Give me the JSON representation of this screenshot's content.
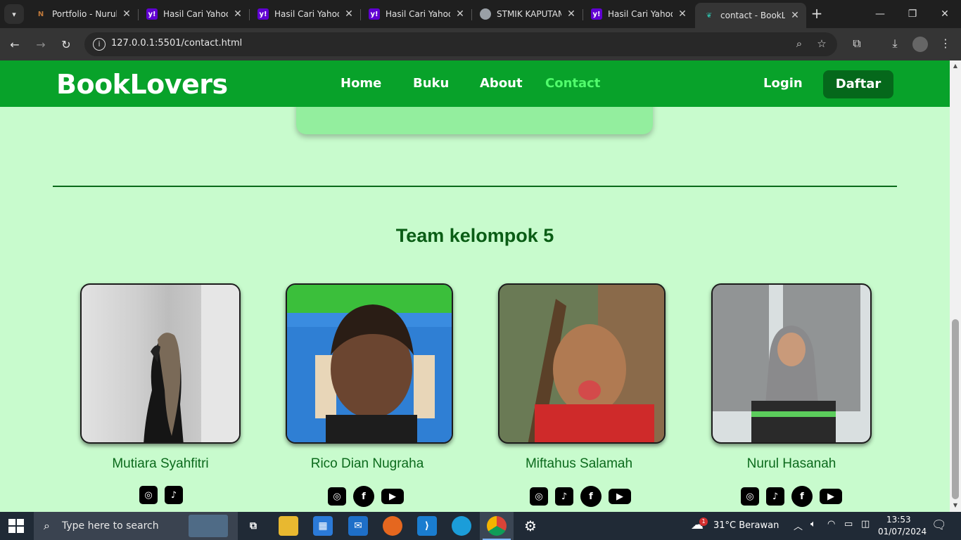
{
  "browser": {
    "tabs": [
      {
        "title": "Portfolio - Nurul",
        "favicon": "N",
        "favicon_color": "#c0793a"
      },
      {
        "title": "Hasil Cari Yahoo",
        "favicon": "y!",
        "favicon_color": "#6001d2"
      },
      {
        "title": "Hasil Cari Yahoo",
        "favicon": "y!",
        "favicon_color": "#6001d2"
      },
      {
        "title": "Hasil Cari Yahoo",
        "favicon": "y!",
        "favicon_color": "#6001d2"
      },
      {
        "title": "STMIK KAPUTAM",
        "favicon": "globe",
        "favicon_color": "#9aa0a6"
      },
      {
        "title": "Hasil Cari Yahoo",
        "favicon": "y!",
        "favicon_color": "#6001d2"
      },
      {
        "title": "contact - BookLo",
        "favicon": "book",
        "favicon_color": "#2fb3a0"
      }
    ],
    "url": "127.0.0.1:5501/contact.html"
  },
  "site": {
    "brand": "BookLovers",
    "nav": [
      "Home",
      "Buku",
      "About",
      "Contact"
    ],
    "active_nav": "Contact",
    "login": "Login",
    "register": "Daftar",
    "colors": {
      "nav_bg": "#08a22a",
      "page_bg": "#c8fbcd",
      "active_link": "#51fb6c",
      "title": "#0a5d15"
    }
  },
  "team": {
    "title": "Team kelompok 5",
    "members": [
      {
        "name": "Mutiara Syahfitri",
        "socials": [
          "instagram-icon",
          "tiktok-icon"
        ]
      },
      {
        "name": "Rico Dian Nugraha",
        "socials": [
          "instagram-icon",
          "facebook-icon",
          "youtube-icon"
        ]
      },
      {
        "name": "Miftahus Salamah",
        "socials": [
          "instagram-icon",
          "tiktok-icon",
          "facebook-icon",
          "youtube-icon"
        ]
      },
      {
        "name": "Nurul Hasanah",
        "socials": [
          "instagram-icon",
          "tiktok-icon",
          "facebook-icon",
          "youtube-icon"
        ]
      }
    ]
  },
  "taskbar": {
    "search_placeholder": "Type here to search",
    "weather": "31°C  Berawan",
    "time": "13:53",
    "date": "01/07/2024",
    "notification_count": "1"
  }
}
